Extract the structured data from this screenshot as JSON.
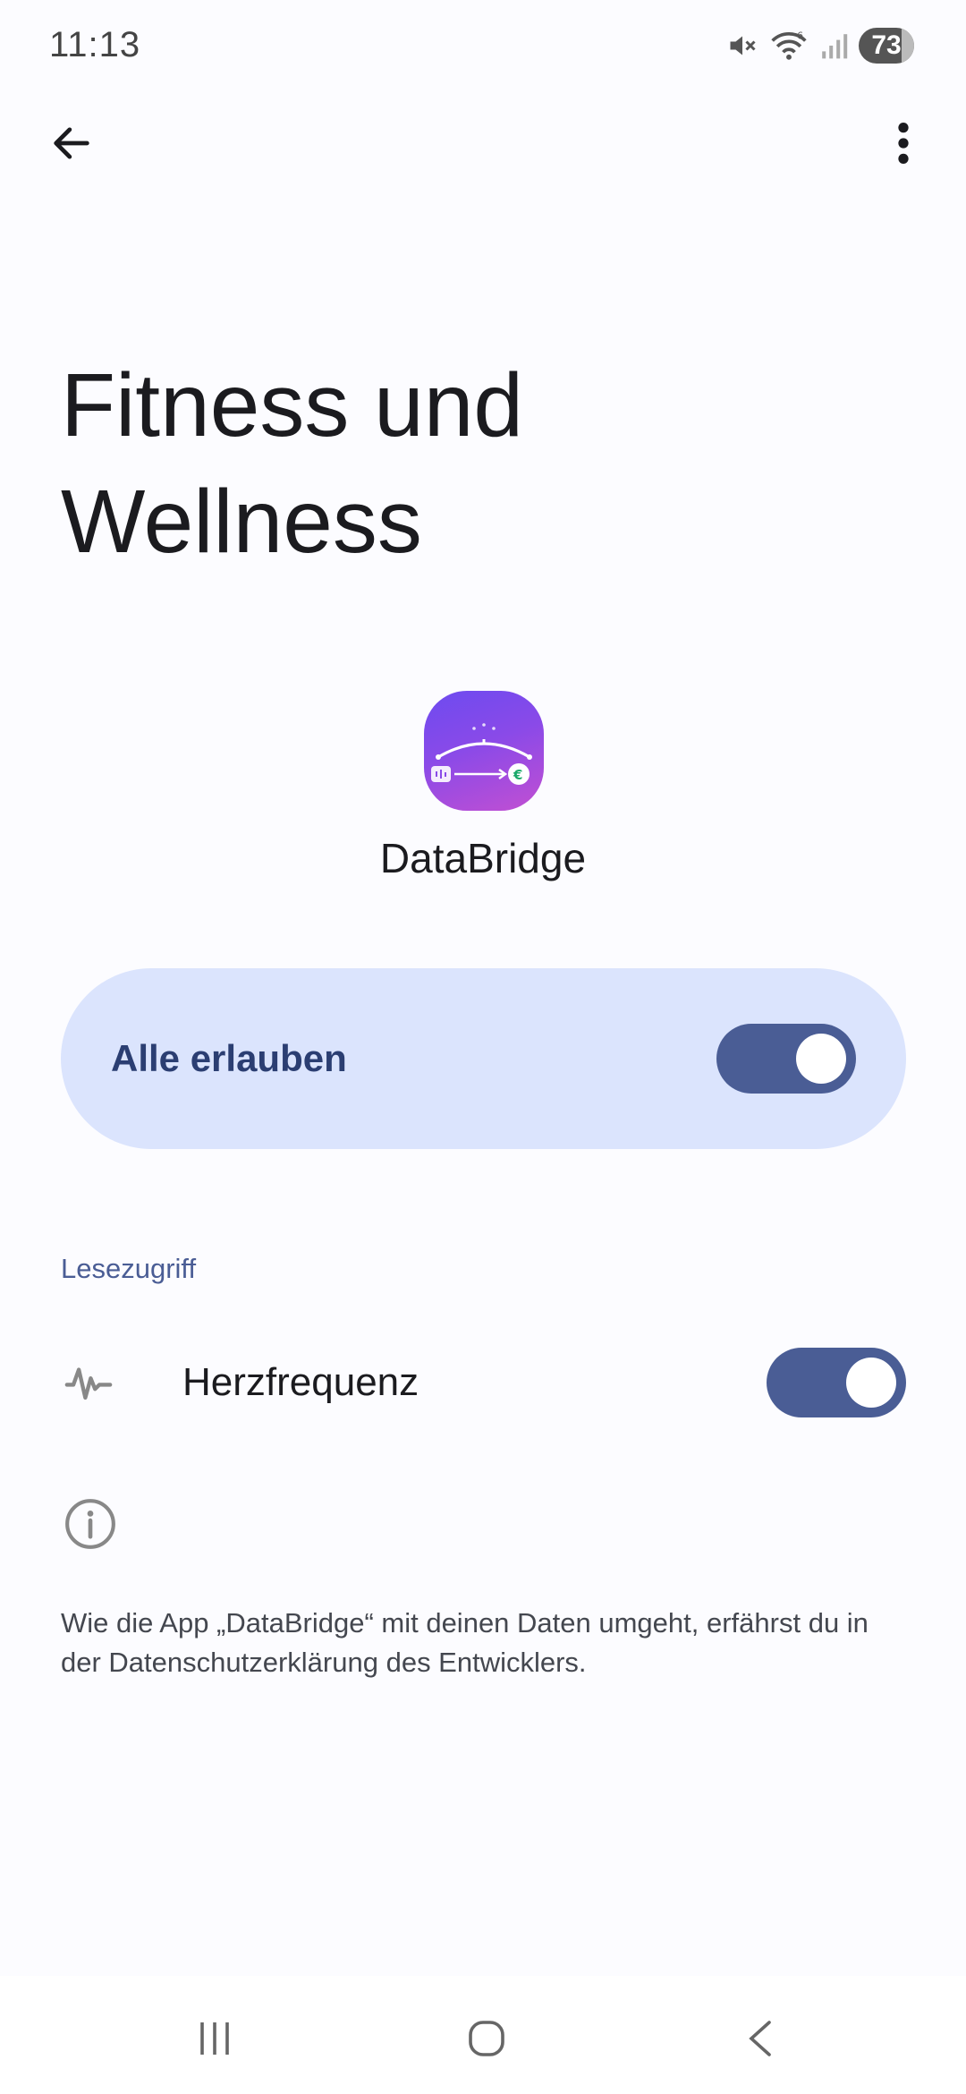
{
  "status_bar": {
    "time": "11:13",
    "battery": "73",
    "icons": [
      "mute-icon",
      "wifi-icon",
      "signal-icon",
      "battery-icon"
    ]
  },
  "app_bar": {
    "back_icon": "arrow-left-icon",
    "menu_icon": "more-vertical-icon"
  },
  "page": {
    "title_line1": "Fitness und",
    "title_line2": "Wellness"
  },
  "app": {
    "name": "DataBridge",
    "icon": "databridge-app-icon"
  },
  "allow_all": {
    "label": "Alle erlauben",
    "enabled": true
  },
  "read_access": {
    "header": "Lesezugriff",
    "items": [
      {
        "label": "Herzfrequenz",
        "icon": "heart-rate-icon",
        "enabled": true
      }
    ]
  },
  "privacy": {
    "icon": "info-icon",
    "text": "Wie die App „DataBridge“ mit deinen Daten umgeht, erfährst du in der Datenschutzerklärung des Entwicklers."
  },
  "nav_bar": {
    "icons": [
      "recents-icon",
      "home-icon",
      "back-icon"
    ]
  },
  "colors": {
    "background": "#fcfcff",
    "card": "#dbe4fd",
    "accent": "#4a5d95",
    "card_text": "#2b3e72"
  }
}
